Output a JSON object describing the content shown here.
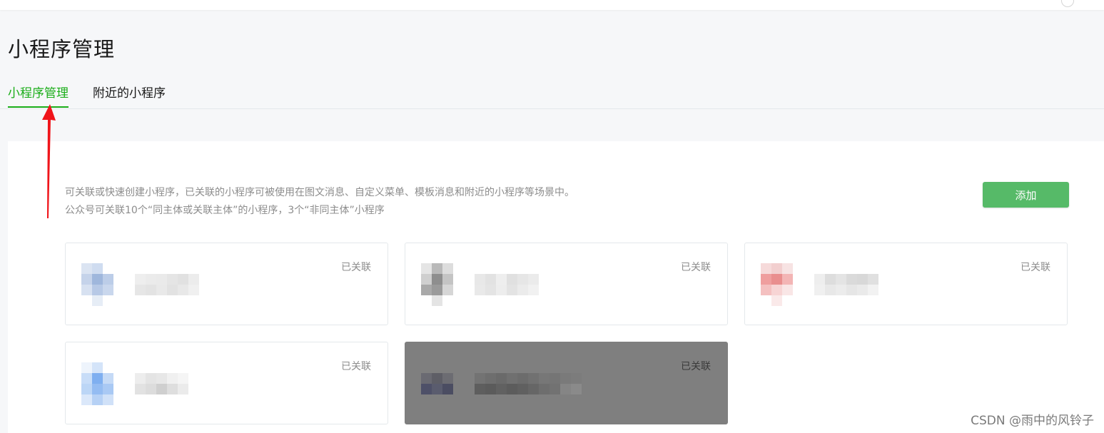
{
  "header": {
    "page_title": "小程序管理"
  },
  "tabs": [
    {
      "label": "小程序管理",
      "active": true
    },
    {
      "label": "附近的小程序",
      "active": false
    }
  ],
  "panel": {
    "description_line1": "可关联或快速创建小程序，已关联的小程序可被使用在图文消息、自定义菜单、模板消息和附近的小程序等场景中。",
    "description_line2": "公众号可关联10个“同主体或关联主体”的小程序，3个“非同主体”小程序",
    "add_button": "添加"
  },
  "mini_programs": [
    {
      "status": "已关联",
      "name": "",
      "logo": "blurred-logo"
    },
    {
      "status": "已关联",
      "name": "",
      "logo": "blurred-logo"
    },
    {
      "status": "已关联",
      "name": "",
      "logo": "blurred-logo"
    },
    {
      "status": "已关联",
      "name": "",
      "logo": "blurred-logo"
    },
    {
      "status": "已关联",
      "name": "",
      "logo": "blurred-logo"
    }
  ],
  "watermark": "CSDN @雨中的风铃子",
  "colors": {
    "accent_green": "#1aad19",
    "button_green": "#56ba68",
    "annotation_red": "#f0141a"
  }
}
